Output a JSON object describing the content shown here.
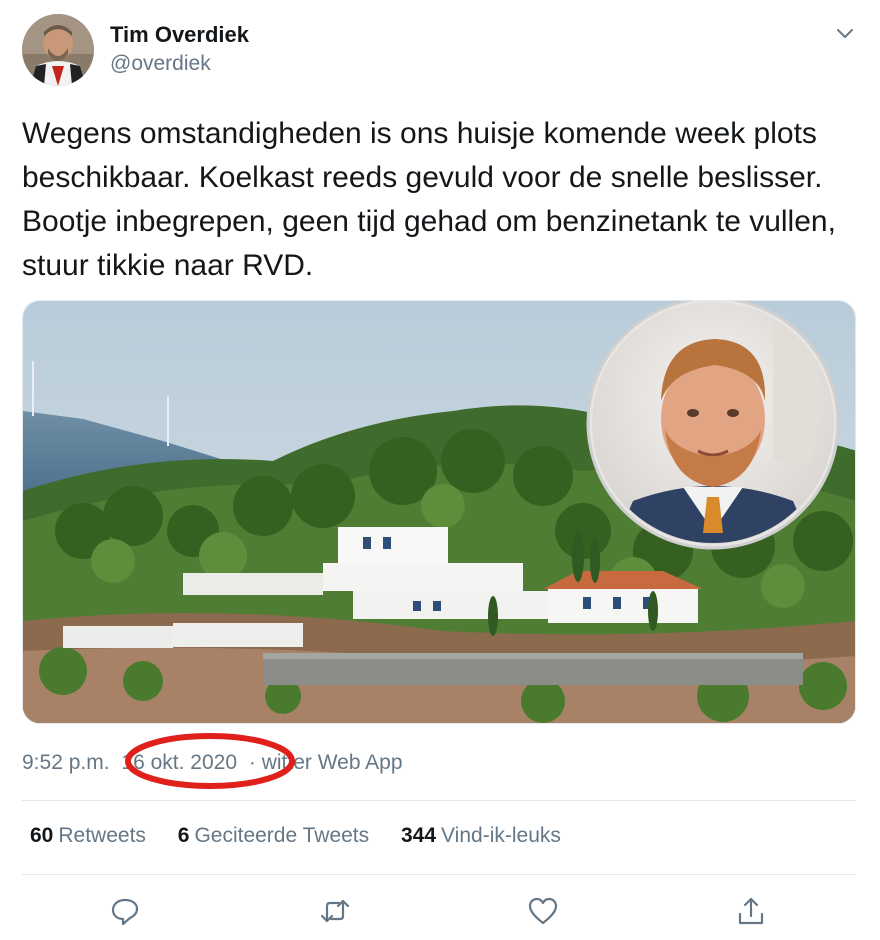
{
  "author": {
    "name": "Tim Overdiek",
    "handle": "@overdiek"
  },
  "tweet": {
    "text": "Wegens omstandigheden is ons huisje komende week plots beschikbaar. Koelkast reeds gevuld voor de snelle beslisser. Bootje inbegrepen, geen tijd gehad om benzinetank te vullen, stuur tikkie naar RVD.",
    "time": "9:52 p.m.",
    "date": "16 okt. 2020",
    "separator": "·",
    "source": "witter Web App"
  },
  "stats": {
    "retweets_count": "60",
    "retweets_label": "Retweets",
    "quotes_count": "6",
    "quotes_label": "Geciteerde Tweets",
    "likes_count": "344",
    "likes_label": "Vind-ik-leuks"
  },
  "actions": [
    "reply-icon",
    "retweet-icon",
    "like-icon",
    "share-icon"
  ],
  "colors": {
    "text": "#14171a",
    "secondary": "#657786",
    "divider": "#e1e8ed",
    "highlight_ring": "#e0201b"
  }
}
